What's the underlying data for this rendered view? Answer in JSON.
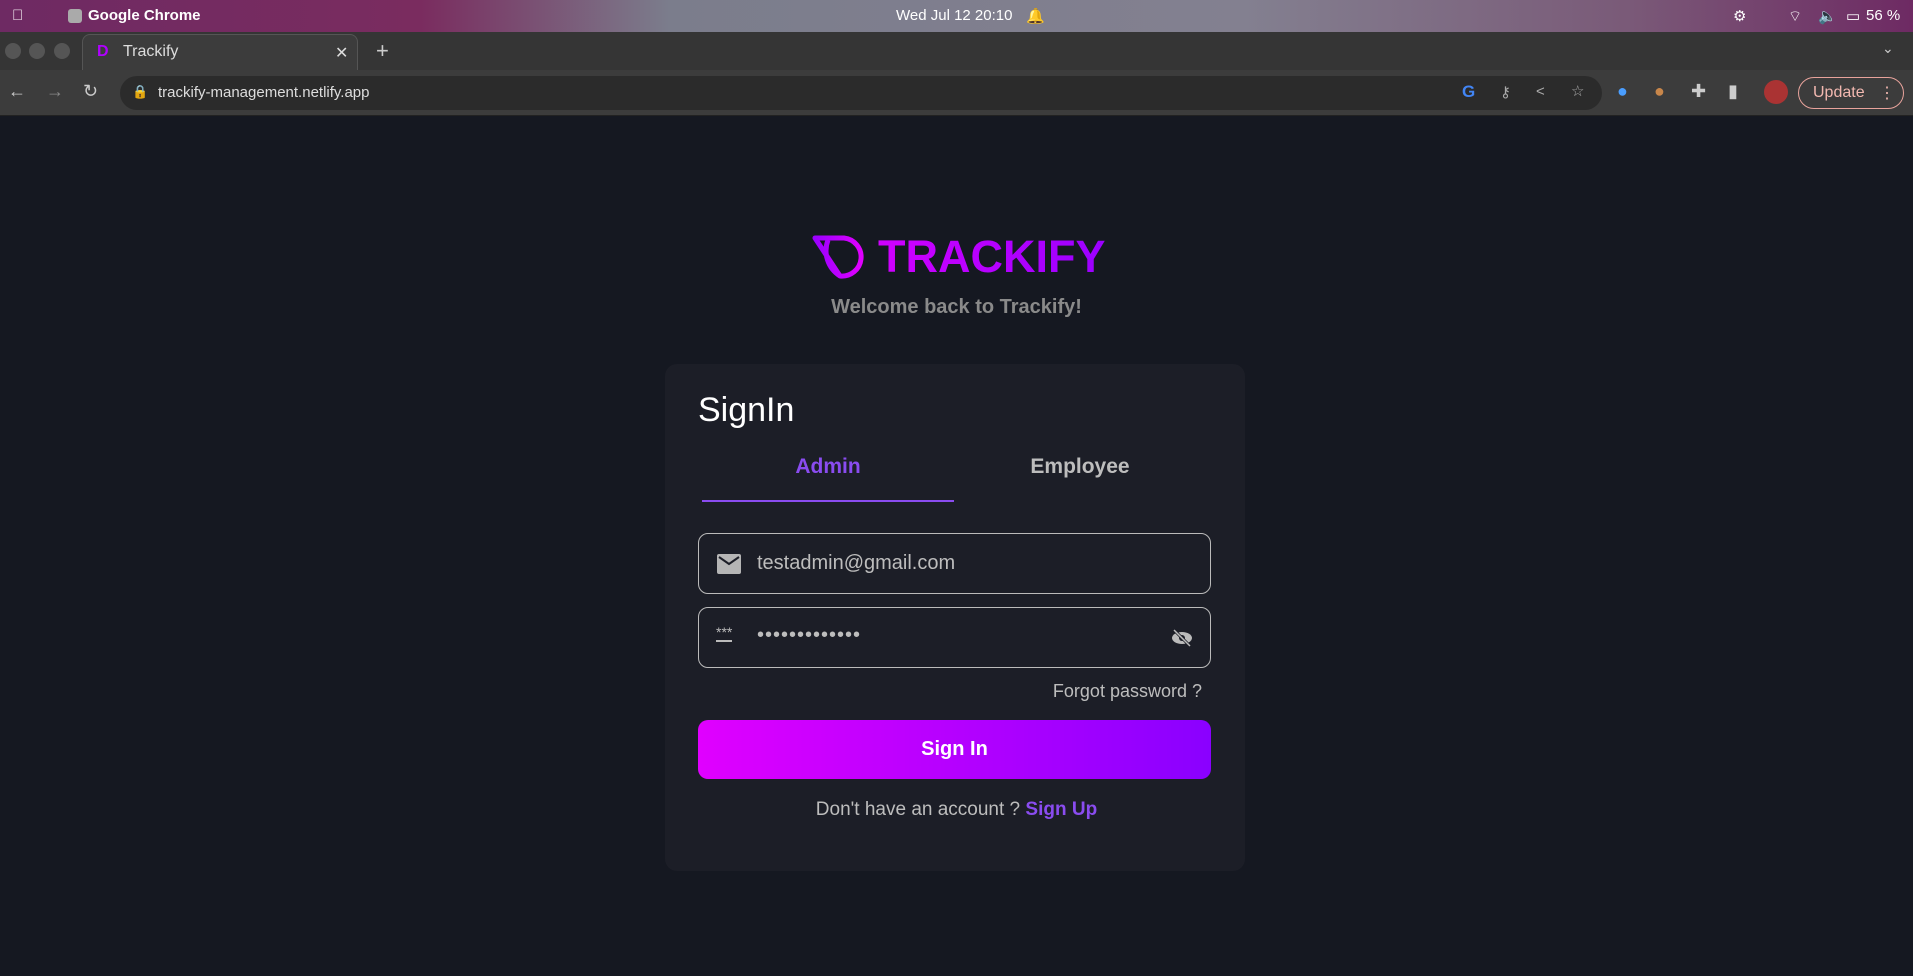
{
  "os": {
    "app": "Google Chrome",
    "clock": "Wed Jul 12  20:10",
    "battery": "56 %"
  },
  "browser": {
    "tab_title": "Trackify",
    "url": "trackify-management.netlify.app",
    "update_label": "Update"
  },
  "page": {
    "logo": "TRACKIFY",
    "welcome": "Welcome back to Trackify!",
    "title": "SignIn",
    "tabs": [
      {
        "label": "Admin",
        "active": true
      },
      {
        "label": "Employee",
        "active": false
      }
    ],
    "email_value": "testadmin@gmail.com",
    "password_value": "•••••••••••••",
    "forgot": "Forgot password ?",
    "signin_label": "Sign In",
    "no_account": "Don't have an account ?",
    "signup_label": "Sign Up"
  },
  "colors": {
    "accent": "#8a4cf0",
    "gradient_start": "#e000ff",
    "gradient_end": "#8a00ff",
    "bg": "#151821",
    "card": "#1c1e27"
  }
}
